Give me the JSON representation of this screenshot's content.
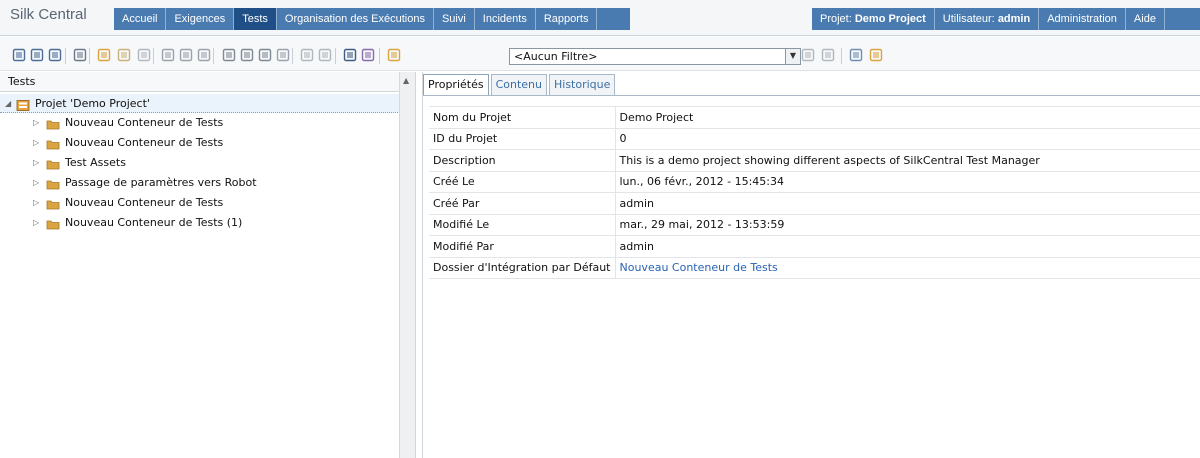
{
  "app": {
    "brand": "Silk Central"
  },
  "nav": {
    "left": [
      {
        "label": "Accueil"
      },
      {
        "label": "Exigences"
      },
      {
        "label": "Tests",
        "active": true
      },
      {
        "label": "Organisation des Exécutions"
      },
      {
        "label": "Suivi"
      },
      {
        "label": "Incidents"
      },
      {
        "label": "Rapports"
      }
    ],
    "right": [
      {
        "label": "Projet: ",
        "bold": "Demo Project"
      },
      {
        "label": "Utilisateur: ",
        "bold": "admin"
      },
      {
        "label": "Administration"
      },
      {
        "label": "Aide"
      }
    ]
  },
  "toolbar": {
    "filter_value": "<Aucun Filtre>",
    "icons": [
      "tree-view-icon",
      "details-view-icon",
      "grid-view-icon",
      "move-up-icon",
      "new-container-icon",
      "new-folder-icon",
      "new-test-icon",
      "edit-icon",
      "properties-icon",
      "delete-icon",
      "cut-icon",
      "copy-icon",
      "paste-icon",
      "paste-special-icon",
      "export-icon",
      "import-icon",
      "find-icon",
      "find-replace-icon",
      "new-filter-icon",
      "filter-icon",
      "clear-filter-icon",
      "edit-filter-icon",
      "search-results-icon",
      "settings-icon"
    ]
  },
  "tree": {
    "header": "Tests",
    "root": "Projet 'Demo Project'",
    "children": [
      "Nouveau Conteneur de Tests",
      "Nouveau Conteneur de Tests",
      "Test Assets",
      "Passage de paramètres vers Robot",
      "Nouveau Conteneur de Tests",
      "Nouveau Conteneur de Tests (1)"
    ]
  },
  "tabs": [
    {
      "label": "Propriétés",
      "active": true
    },
    {
      "label": "Contenu"
    },
    {
      "label": "Historique"
    }
  ],
  "properties": [
    {
      "label": "Nom du Projet",
      "value": "Demo Project"
    },
    {
      "label": "ID du Projet",
      "value": "0"
    },
    {
      "label": "Description",
      "value": "This is a demo project showing different aspects of SilkCentral Test Manager"
    },
    {
      "label": "Créé Le",
      "value": "lun., 06 févr., 2012 - 15:45:34"
    },
    {
      "label": "Créé Par",
      "value": "admin"
    },
    {
      "label": "Modifié Le",
      "value": "mar., 29 mai, 2012 - 13:53:59"
    },
    {
      "label": "Modifié Par",
      "value": "admin"
    },
    {
      "label": "Dossier d'Intégration par Défaut",
      "value": "Nouveau Conteneur de Tests",
      "link": true
    }
  ],
  "colors": {
    "nav_bg": "#4a7bb0",
    "nav_active": "#1f4f86",
    "link": "#2a63b1",
    "folder": "#d9a441"
  }
}
